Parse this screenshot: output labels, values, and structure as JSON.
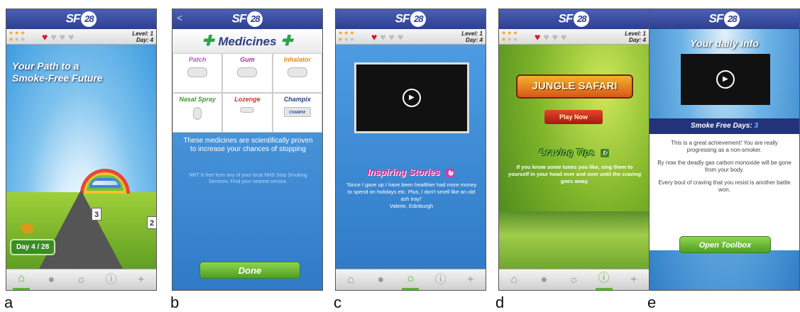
{
  "common": {
    "logo_text": "SF",
    "logo_badge": "28",
    "level_text": "Level: 1",
    "day_text": "Day: 4"
  },
  "captions": [
    "a",
    "b",
    "c",
    "d",
    "e"
  ],
  "screen_a": {
    "title": "Your Path to a Smoke-Free Future",
    "sign_near": "3",
    "sign_far": "2",
    "day_progress": "Day 4 / 28"
  },
  "screen_b": {
    "back_glyph": "<",
    "heading": "Medicines",
    "medicines": [
      {
        "label": "Patch",
        "color": "#b35bc4"
      },
      {
        "label": "Gum",
        "color": "#a03090"
      },
      {
        "label": "Inhalator",
        "color": "#e28a1a"
      },
      {
        "label": "Nasal Spray",
        "color": "#3a9a2a"
      },
      {
        "label": "Lozenge",
        "color": "#c0392b"
      },
      {
        "label": "Champix",
        "color": "#2a3d88"
      }
    ],
    "champix_box": "CHAMPIX",
    "info_text": "These medicines are scientifically proven to increase your chances of stopping",
    "small_text": "NRT is free from any of your local NHS Stop Smoking Services. Find your nearest service.",
    "done_label": "Done"
  },
  "screen_c": {
    "section_title": "Inspiring Stories",
    "quote": "'Since I gave up I have been healthier had more money to spend on holidays etc. Plus, I don't smell like an old ash tray!'",
    "author": "Valerie, Edinburgh"
  },
  "screen_d": {
    "game_title": "JUNGLE SAFARI",
    "play_label": "Play Now",
    "section_title": "Craving Tips",
    "tip_text": "If you know some tunes you like, sing them to yourself in your head over and over until the craving goes away."
  },
  "screen_e": {
    "title": "Your daily info",
    "smoke_free_label": "Smoke Free Days:",
    "smoke_free_value": "3",
    "para1": "This is a great achievement! You are really progressing as a non-smoker.",
    "para2": "By now the deadly gas carbon monoxide will be gone from your body.",
    "para3": "Every bout of craving that you resist is another battle won.",
    "toolbox_label": "Open Toolbox"
  },
  "colors": {
    "heart_on": "#d4162b",
    "nav_active": "#5bb82e",
    "stories_title": "#e0308f",
    "tips_title": "#6fc23a"
  }
}
